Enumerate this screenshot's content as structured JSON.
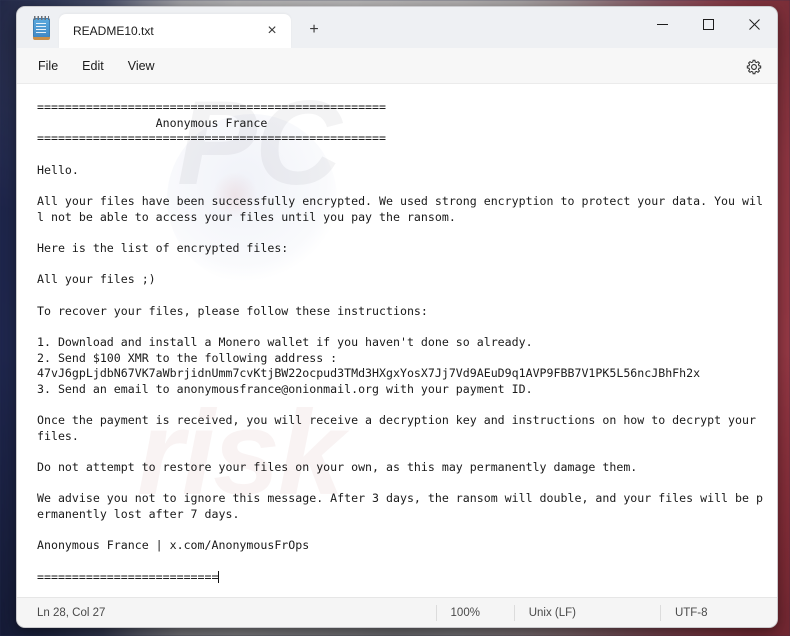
{
  "window": {
    "app_icon": "notepad-icon",
    "tab_label": "README10.txt",
    "tab_close_icon": "×",
    "new_tab_icon": "+",
    "minimize_icon": "─",
    "maximize_icon": "□",
    "close_icon": "✕"
  },
  "menubar": {
    "items": [
      {
        "label": "File"
      },
      {
        "label": "Edit"
      },
      {
        "label": "View"
      }
    ],
    "settings_icon": "gear-icon"
  },
  "document": {
    "name": "README10.txt",
    "content": "==================================================\n                 Anonymous France\n==================================================\n\nHello.\n\nAll your files have been successfully encrypted. We used strong encryption to protect your data. You will not be able to access your files until you pay the ransom.\n\nHere is the list of encrypted files:\n\nAll your files ;)\n\nTo recover your files, please follow these instructions:\n\n1. Download and install a Monero wallet if you haven't done so already.\n2. Send $100 XMR to the following address :\n47vJ6gpLjdbN67VK7aWbrjidnUmm7cvKtjBW22ocpud3TMd3HXgxYosX7Jj7Vd9AEuD9q1AVP9FBB7V1PK5L56ncJBhFh2x\n3. Send an email to anonymousfrance@onionmail.org with your payment ID.\n\nOnce the payment is received, you will receive a decryption key and instructions on how to decrypt your files.\n\nDo not attempt to restore your files on your own, as this may permanently damage them.\n\nWe advise you not to ignore this message. After 3 days, the ransom will double, and your files will be permanently lost after 7 days.\n\nAnonymous France | x.com/AnonymousFrOps\n\n==========================",
    "lines": {
      "separator_top": "==================================================",
      "title_line": "                 Anonymous France",
      "separator_mid": "==================================================",
      "greeting": "Hello.",
      "intro": "All your files have been successfully encrypted. We used strong encryption to protect your data. You will not be able to access your files until you pay the ransom.",
      "list_header": "Here is the list of encrypted files:",
      "list_body": "All your files ;)",
      "instructions_header": "To recover your files, please follow these instructions:",
      "step_1": "1. Download and install a Monero wallet if you haven't done so already.",
      "step_2": "2. Send $100 XMR to the following address :",
      "wallet_address": "47vJ6gpLjdbN67VK7aWbrjidnUmm7cvKtjBW22ocpud3TMd3HXgxYosX7Jj7Vd9AEuD9q1AVP9FBB7V1PK5L56ncJBhFh2x",
      "step_3": "3. Send an email to anonymousfrance@onionmail.org with your payment ID.",
      "after_payment": "Once the payment is received, you will receive a decryption key and instructions on how to decrypt your files.",
      "warning_restore": "Do not attempt to restore your files on your own, as this may permanently damage them.",
      "warning_deadline": "We advise you not to ignore this message. After 3 days, the ransom will double, and your files will be permanently lost after 7 days.",
      "signature": "Anonymous France | x.com/AnonymousFrOps",
      "separator_bottom": "=========================="
    },
    "contact_email": "anonymousfrance@onionmail.org",
    "ransom_amount": "$100 XMR",
    "social_handle": "x.com/AnonymousFrOps",
    "deadline_double_days": "3",
    "deadline_lost_days": "7"
  },
  "statusbar": {
    "position": "Ln 28, Col 27",
    "zoom": "100%",
    "line_ending": "Unix (LF)",
    "encoding": "UTF-8"
  },
  "watermark": {
    "text1": "PC",
    "text2": "risk"
  },
  "colors": {
    "window_bg": "#f7f7f7",
    "editor_bg": "#ffffff",
    "tab_active": "#ffffff",
    "titlebar": "#eef0f3",
    "text": "#1a1a1a",
    "status_text": "#4a4a4a",
    "wallpaper_blue": "#1f2750",
    "wallpaper_white": "#eceaea",
    "wallpaper_red": "#9e3b48"
  }
}
